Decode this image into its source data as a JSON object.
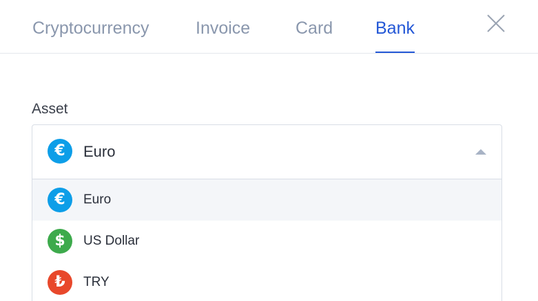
{
  "tabs": [
    {
      "label": "Cryptocurrency",
      "active": false
    },
    {
      "label": "Invoice",
      "active": false
    },
    {
      "label": "Card",
      "active": false
    },
    {
      "label": "Bank",
      "active": true
    }
  ],
  "asset_field": {
    "label": "Asset",
    "selected": {
      "label": "Euro",
      "icon": "euro-icon",
      "symbol": "€",
      "color": "#0d9ee8"
    }
  },
  "options": [
    {
      "label": "Euro",
      "icon": "euro-icon",
      "symbol": "€",
      "color": "#0d9ee8"
    },
    {
      "label": "US Dollar",
      "icon": "dollar-icon",
      "symbol": "$",
      "color": "#3daa4c"
    },
    {
      "label": "TRY",
      "icon": "lira-icon",
      "symbol": "₺",
      "color": "#e8482b"
    }
  ],
  "colors": {
    "accent": "#2357d6",
    "inactive_tab": "#8a97ad"
  }
}
